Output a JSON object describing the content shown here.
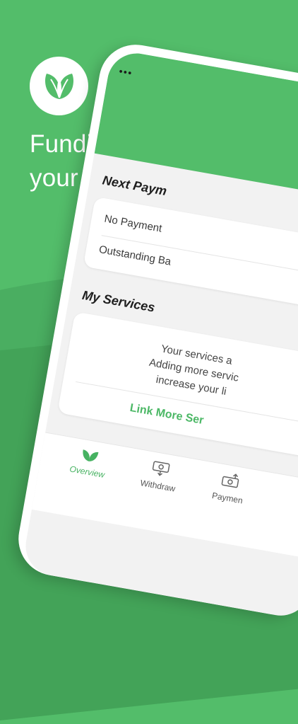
{
  "headline": "Funding that fits your business.",
  "screen": {
    "status_dots": "●●●",
    "next_payment": {
      "title": "Next Paym",
      "row1": "No Payment",
      "row2": "Outstanding Ba"
    },
    "services": {
      "title": "My Services",
      "line1": "Your services a",
      "line2": "Adding more servic",
      "line3": "increase your li",
      "link": "Link More Ser"
    },
    "tabs": [
      {
        "label": "Overview",
        "icon": "leaf-icon"
      },
      {
        "label": "Withdraw",
        "icon": "withdraw-icon"
      },
      {
        "label": "Paymen",
        "icon": "payment-icon"
      }
    ]
  },
  "colors": {
    "brand_green": "#53bd6a",
    "accent_green": "#46b261"
  }
}
